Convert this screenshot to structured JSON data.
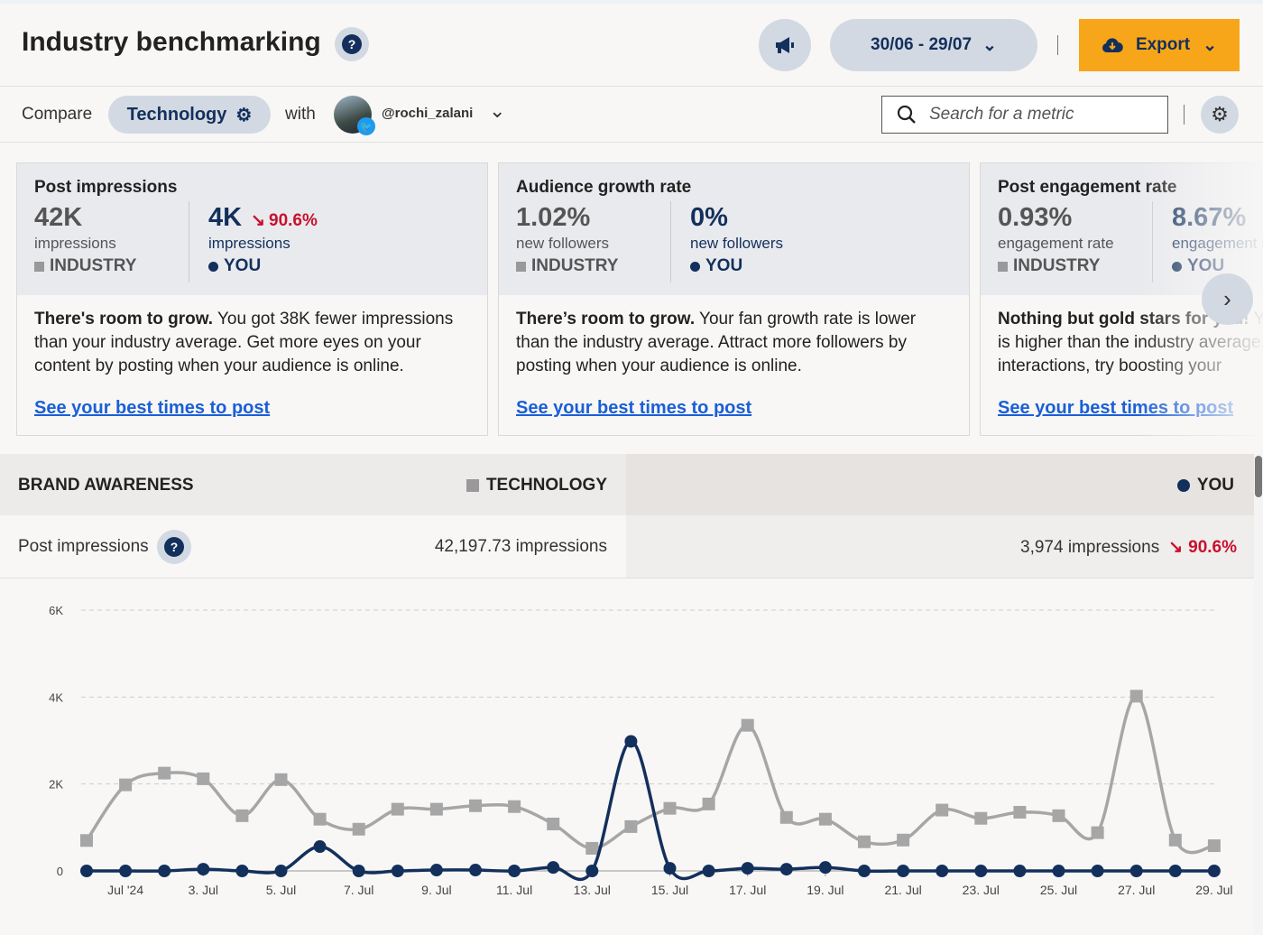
{
  "header": {
    "title": "Industry benchmarking",
    "date_range": "30/06 - 29/07",
    "export_label": "Export"
  },
  "toolbar": {
    "compare_label": "Compare",
    "industry": "Technology",
    "with_label": "with",
    "account": "@rochi_zalani",
    "search_placeholder": "Search for a metric"
  },
  "cards": [
    {
      "title": "Post impressions",
      "industry_value": "42K",
      "industry_unit": "impressions",
      "industry_label": "INDUSTRY",
      "you_value": "4K",
      "you_change": "90.6%",
      "you_change_dir": "down",
      "you_unit": "impressions",
      "you_label": "YOU",
      "headline": "There's room to grow.",
      "text": " You got 38K fewer impressions than your industry average. Get more eyes on your content by posting when your audience is online.",
      "link": "See your best times to post"
    },
    {
      "title": "Audience growth rate",
      "industry_value": "1.02%",
      "industry_unit": "new followers",
      "industry_label": "INDUSTRY",
      "you_value": "0%",
      "you_unit": "new followers",
      "you_label": "YOU",
      "headline": "There’s room to grow.",
      "text": " Your fan growth rate is lower than the industry average. Attract more followers by posting when your audience is online.",
      "link": "See your best times to post"
    },
    {
      "title": "Post engagement rate",
      "industry_value": "0.93%",
      "industry_unit": "engagement rate",
      "industry_label": "INDUSTRY",
      "you_value": "8.67%",
      "you_unit": "engagement rate",
      "you_label": "YOU",
      "headline": "Nothing but gold stars for you!",
      "text": " Your engagement rate is higher than the industry average. To get more interactions, try boosting your",
      "link": "See your best times to post"
    }
  ],
  "table": {
    "section": "BRAND AWARENESS",
    "industry_col": "TECHNOLOGY",
    "you_col": "YOU",
    "row_label": "Post impressions",
    "industry_value": "42,197.73 impressions",
    "you_value": "3,974 impressions",
    "you_change": "90.6%"
  },
  "colors": {
    "accent": "#f8a619",
    "navy": "#13305c",
    "industry": "#a6a6a6",
    "negative": "#c8102e",
    "link": "#1a5fd6"
  },
  "chart_data": {
    "type": "line",
    "x": [
      "30 Jun",
      "1 Jul",
      "2 Jul",
      "3 Jul",
      "4 Jul",
      "5 Jul",
      "6 Jul",
      "7 Jul",
      "8 Jul",
      "9 Jul",
      "10 Jul",
      "11 Jul",
      "12 Jul",
      "13 Jul",
      "14 Jul",
      "15 Jul",
      "16 Jul",
      "17 Jul",
      "18 Jul",
      "19 Jul",
      "20 Jul",
      "21 Jul",
      "22 Jul",
      "23 Jul",
      "24 Jul",
      "25 Jul",
      "26 Jul",
      "27 Jul",
      "28 Jul",
      "29 Jul"
    ],
    "x_tick_labels": [
      "Jul '24",
      "3. Jul",
      "5. Jul",
      "7. Jul",
      "9. Jul",
      "11. Jul",
      "13. Jul",
      "15. Jul",
      "17. Jul",
      "19. Jul",
      "21. Jul",
      "23. Jul",
      "25. Jul",
      "27. Jul",
      "29. Jul"
    ],
    "y_tick_labels": [
      "0",
      "2K",
      "4K",
      "6K"
    ],
    "ylim": [
      0,
      6000
    ],
    "grid": true,
    "series": [
      {
        "name": "TECHNOLOGY",
        "color": "#a6a6a6",
        "marker": "square",
        "values": [
          700,
          1980,
          2250,
          2120,
          1270,
          2100,
          1190,
          960,
          1420,
          1420,
          1500,
          1480,
          1080,
          520,
          1020,
          1440,
          1540,
          3350,
          1230,
          1190,
          670,
          710,
          1400,
          1210,
          1350,
          1270,
          880,
          4020,
          710,
          580
        ]
      },
      {
        "name": "YOU",
        "color": "#13305c",
        "marker": "circle",
        "values": [
          0,
          0,
          0,
          40,
          0,
          0,
          560,
          0,
          0,
          20,
          20,
          0,
          80,
          0,
          2980,
          60,
          0,
          60,
          40,
          80,
          0,
          0,
          0,
          0,
          0,
          0,
          0,
          0,
          0,
          0
        ]
      }
    ]
  }
}
